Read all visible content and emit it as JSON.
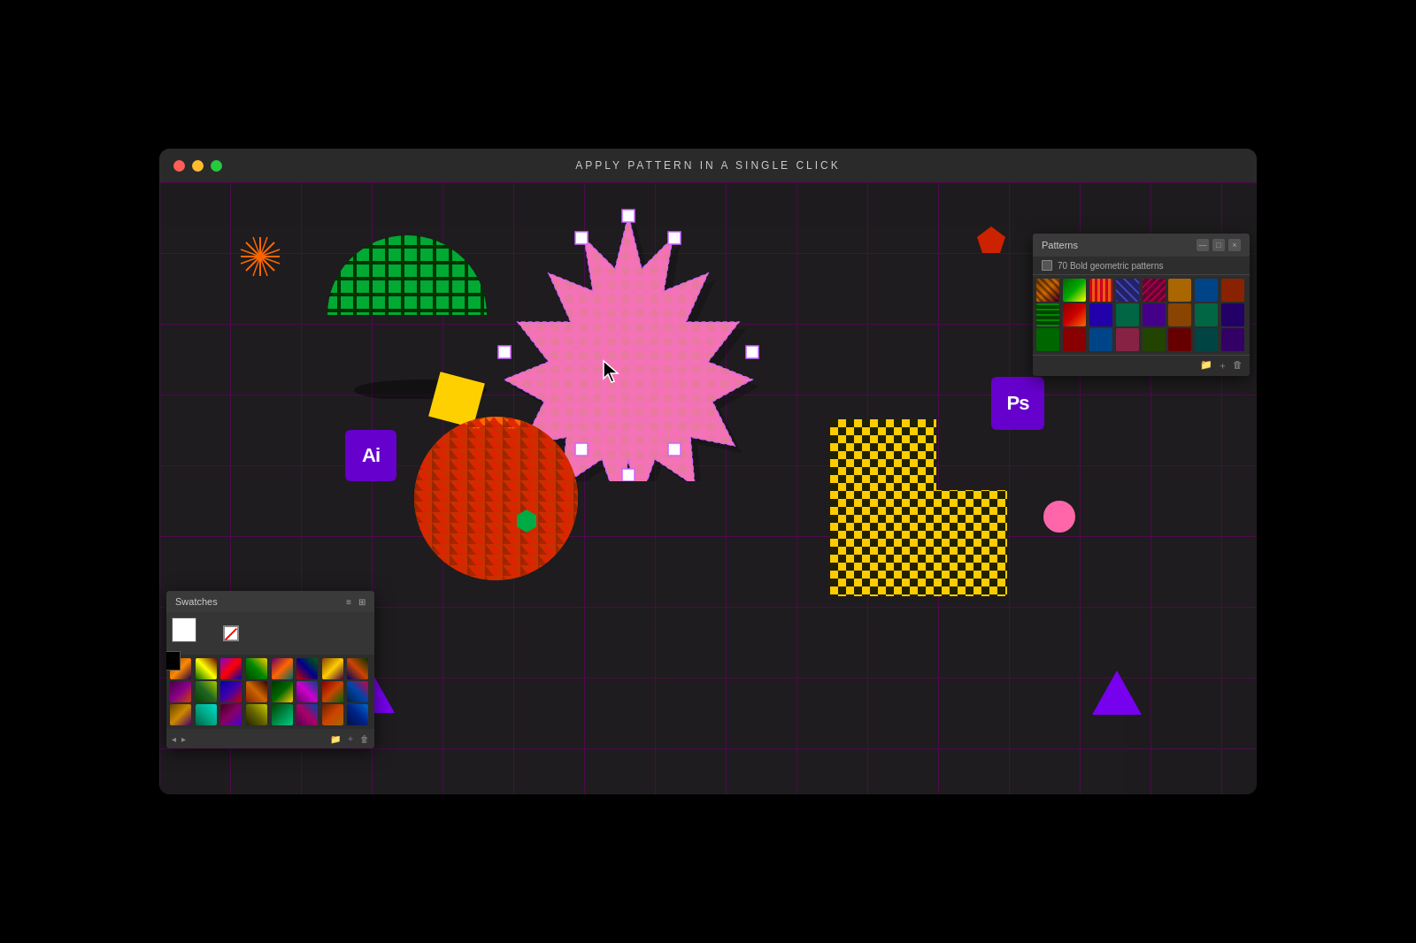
{
  "window": {
    "title": "APPLY PATTERN IN A SINGLE CLICK"
  },
  "traffic_lights": {
    "close": "close",
    "minimize": "minimize",
    "maximize": "maximize"
  },
  "patterns_panel": {
    "title": "Patterns",
    "subtitle": "70 Bold geometric patterns",
    "close_btn": "×",
    "items": [
      {
        "id": 1,
        "color": "#8B1515"
      },
      {
        "id": 2,
        "color": "#CC4400"
      },
      {
        "id": 3,
        "color": "#226622"
      },
      {
        "id": 4,
        "color": "#1122AA"
      },
      {
        "id": 5,
        "color": "#661166"
      },
      {
        "id": 6,
        "color": "#AA8800"
      },
      {
        "id": 7,
        "color": "#004488"
      },
      {
        "id": 8,
        "color": "#882200"
      },
      {
        "id": 9,
        "color": "#004400"
      },
      {
        "id": 10,
        "color": "#CC6600"
      },
      {
        "id": 11,
        "color": "#CC0066"
      },
      {
        "id": 12,
        "color": "#008866"
      },
      {
        "id": 13,
        "color": "#440088"
      },
      {
        "id": 14,
        "color": "#884400"
      },
      {
        "id": 15,
        "color": "#006644"
      },
      {
        "id": 16,
        "color": "#220066"
      },
      {
        "id": 17,
        "color": "#006600"
      },
      {
        "id": 18,
        "color": "#880000"
      },
      {
        "id": 19,
        "color": "#004488"
      },
      {
        "id": 20,
        "color": "#882244"
      },
      {
        "id": 21,
        "color": "#224400"
      },
      {
        "id": 22,
        "color": "#660000"
      },
      {
        "id": 23,
        "color": "#004444"
      },
      {
        "id": 24,
        "color": "#330066"
      }
    ]
  },
  "swatches_panel": {
    "title": "Swatches",
    "items": [
      {
        "id": 1,
        "colors": [
          "#884400",
          "#ff8800",
          "#220044"
        ]
      },
      {
        "id": 2,
        "colors": [
          "#006600",
          "#ffff00",
          "#660000"
        ]
      },
      {
        "id": 3,
        "colors": [
          "#8800cc",
          "#ff0000",
          "#0000aa"
        ]
      },
      {
        "id": 4,
        "colors": [
          "#004400",
          "#008800",
          "#ffcc00"
        ]
      },
      {
        "id": 5,
        "colors": [
          "#660066",
          "#ff6600",
          "#006666"
        ]
      },
      {
        "id": 6,
        "colors": [
          "#cc0000",
          "#000088",
          "#006600"
        ]
      },
      {
        "id": 7,
        "colors": [
          "#884400",
          "#ffcc00",
          "#440044"
        ]
      },
      {
        "id": 8,
        "colors": [
          "#000066",
          "#cc4400",
          "#003300"
        ]
      }
    ]
  },
  "badges": {
    "ai": "Ai",
    "ps": "Ps"
  }
}
